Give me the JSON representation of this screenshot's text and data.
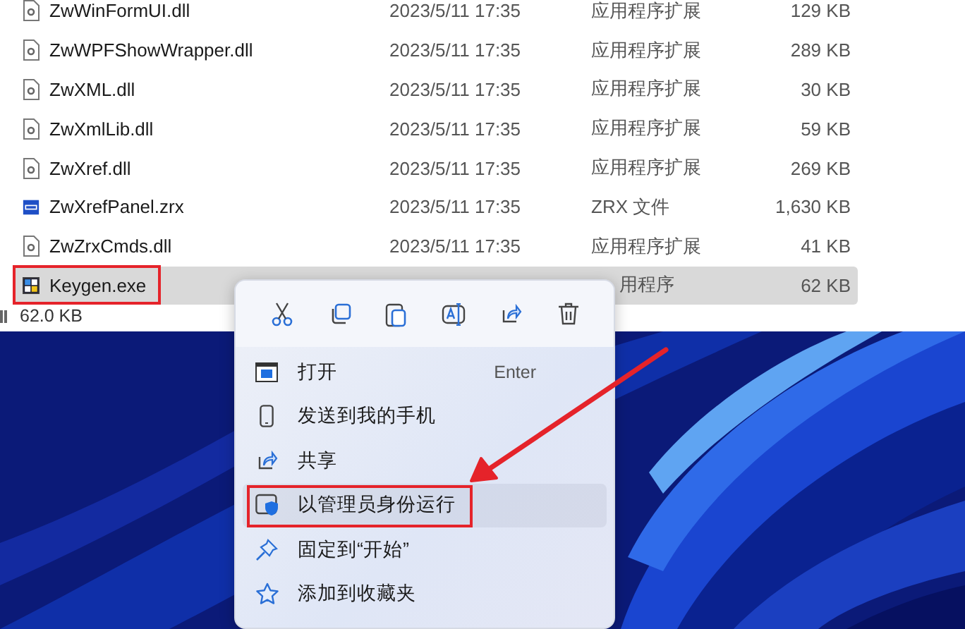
{
  "files": [
    {
      "name": "ZwWinFormUI.dll",
      "date": "2023/5/11 17:35",
      "type": "应用程序扩展",
      "size": "129 KB",
      "kind": "dll",
      "selected": false,
      "highlighted": false
    },
    {
      "name": "ZwWPFShowWrapper.dll",
      "date": "2023/5/11 17:35",
      "type": "应用程序扩展",
      "size": "289 KB",
      "kind": "dll",
      "selected": false,
      "highlighted": false
    },
    {
      "name": "ZwXML.dll",
      "date": "2023/5/11 17:35",
      "type": "应用程序扩展",
      "size": "30 KB",
      "kind": "dll",
      "selected": false,
      "highlighted": false
    },
    {
      "name": "ZwXmlLib.dll",
      "date": "2023/5/11 17:35",
      "type": "应用程序扩展",
      "size": "59 KB",
      "kind": "dll",
      "selected": false,
      "highlighted": false
    },
    {
      "name": "ZwXref.dll",
      "date": "2023/5/11 17:35",
      "type": "应用程序扩展",
      "size": "269 KB",
      "kind": "dll",
      "selected": false,
      "highlighted": false
    },
    {
      "name": "ZwXrefPanel.zrx",
      "date": "2023/5/11 17:35",
      "type": "ZRX 文件",
      "size": "1,630 KB",
      "kind": "zrx",
      "selected": false,
      "highlighted": false
    },
    {
      "name": "ZwZrxCmds.dll",
      "date": "2023/5/11 17:35",
      "type": "应用程序扩展",
      "size": "41 KB",
      "kind": "dll",
      "selected": false,
      "highlighted": false
    },
    {
      "name": "Keygen.exe",
      "type": "用程序",
      "size": "62 KB",
      "kind": "exe",
      "selected": true,
      "highlighted": true,
      "partly_covered": true
    }
  ],
  "status_bar": {
    "selection_size": "62.0 KB"
  },
  "context_menu": {
    "toolbar": [
      {
        "kind": "cut"
      },
      {
        "kind": "copy"
      },
      {
        "kind": "paste"
      },
      {
        "kind": "rename"
      },
      {
        "kind": "share"
      },
      {
        "kind": "delete"
      }
    ],
    "items": [
      {
        "label": "打开",
        "shortcut": "Enter",
        "kind": "open",
        "selected": false,
        "highlighted": false
      },
      {
        "label": "发送到我的手机",
        "kind": "phone",
        "selected": false,
        "highlighted": false
      },
      {
        "label": "共享",
        "kind": "share",
        "selected": false,
        "highlighted": false
      },
      {
        "label": "以管理员身份运行",
        "kind": "admin",
        "selected": true,
        "highlighted": true
      },
      {
        "label": "固定到“开始”",
        "kind": "pin",
        "selected": false,
        "highlighted": false
      },
      {
        "label": "添加到收藏夹",
        "kind": "star",
        "selected": false,
        "highlighted": false
      }
    ]
  }
}
